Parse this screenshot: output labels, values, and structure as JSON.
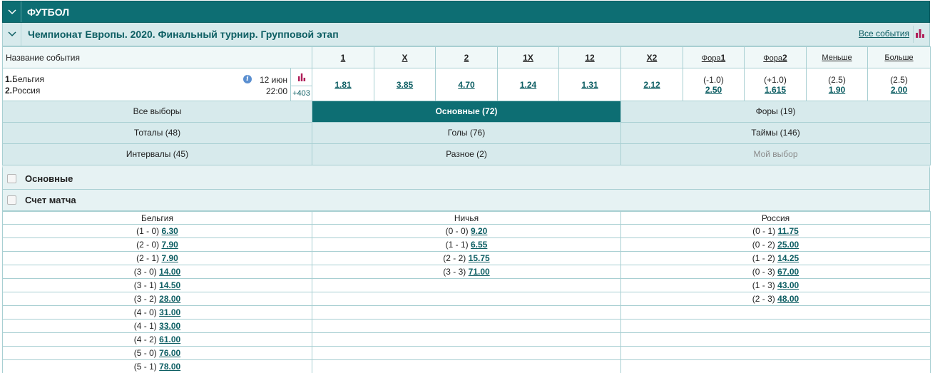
{
  "sport": {
    "title": "ФУТБОЛ"
  },
  "tournament": {
    "title": "Чемпионат Европы. 2020. Финальный турнир. Групповой этап",
    "all_events": "Все события"
  },
  "table": {
    "name_header": "Название события",
    "columns": [
      "1",
      "X",
      "2",
      "1X",
      "12",
      "X2"
    ],
    "fora1_prefix": "Фора",
    "fora1_suffix": "1",
    "fora2_prefix": "Фора",
    "fora2_suffix": "2",
    "less": "Меньше",
    "more": "Больше"
  },
  "event": {
    "team1_num": "1.",
    "team1": "Бельгия",
    "team2_num": "2.",
    "team2": "Россия",
    "date": "12 июн",
    "time": "22:00",
    "more_count": "+403",
    "odds": [
      "1.81",
      "3.85",
      "4.70",
      "1.24",
      "1.31",
      "2.12"
    ],
    "fora1_hcp": "(-1.0)",
    "fora1_odd": "2.50",
    "fora2_hcp": "(+1.0)",
    "fora2_odd": "1.615",
    "less_total": "(2.5)",
    "less_odd": "1.90",
    "more_total": "(2.5)",
    "more_odd": "2.00"
  },
  "filters": [
    [
      "Все выборы",
      "Основные (72)",
      "Форы (19)"
    ],
    [
      "Тоталы (48)",
      "Голы (76)",
      "Таймы (146)"
    ],
    [
      "Интервалы (45)",
      "Разное (2)",
      "Мой выбор"
    ]
  ],
  "sections": {
    "main": "Основные",
    "score": "Счет матча"
  },
  "scores": {
    "headers": [
      "Бельгия",
      "Ничья",
      "Россия"
    ],
    "rows": [
      [
        [
          "(1 - 0)",
          "6.30"
        ],
        [
          "(0 - 0)",
          "9.20"
        ],
        [
          "(0 - 1)",
          "11.75"
        ]
      ],
      [
        [
          "(2 - 0)",
          "7.90"
        ],
        [
          "(1 - 1)",
          "6.55"
        ],
        [
          "(0 - 2)",
          "25.00"
        ]
      ],
      [
        [
          "(2 - 1)",
          "7.90"
        ],
        [
          "(2 - 2)",
          "15.75"
        ],
        [
          "(1 - 2)",
          "14.25"
        ]
      ],
      [
        [
          "(3 - 0)",
          "14.00"
        ],
        [
          "(3 - 3)",
          "71.00"
        ],
        [
          "(0 - 3)",
          "67.00"
        ]
      ],
      [
        [
          "(3 - 1)",
          "14.50"
        ],
        [
          "",
          ""
        ],
        [
          "(1 - 3)",
          "43.00"
        ]
      ],
      [
        [
          "(3 - 2)",
          "28.00"
        ],
        [
          "",
          ""
        ],
        [
          "(2 - 3)",
          "48.00"
        ]
      ],
      [
        [
          "(4 - 0)",
          "31.00"
        ],
        [
          "",
          ""
        ],
        [
          "",
          ""
        ]
      ],
      [
        [
          "(4 - 1)",
          "33.00"
        ],
        [
          "",
          ""
        ],
        [
          "",
          ""
        ]
      ],
      [
        [
          "(4 - 2)",
          "61.00"
        ],
        [
          "",
          ""
        ],
        [
          "",
          ""
        ]
      ],
      [
        [
          "(5 - 0)",
          "76.00"
        ],
        [
          "",
          ""
        ],
        [
          "",
          ""
        ]
      ],
      [
        [
          "(5 - 1)",
          "78.00"
        ],
        [
          "",
          ""
        ],
        [
          "",
          ""
        ]
      ]
    ]
  },
  "colors": {
    "accent": "#0d6e73",
    "light": "#d7eaec",
    "link": "#0d5e63",
    "chart_icon": "#b0205a"
  }
}
